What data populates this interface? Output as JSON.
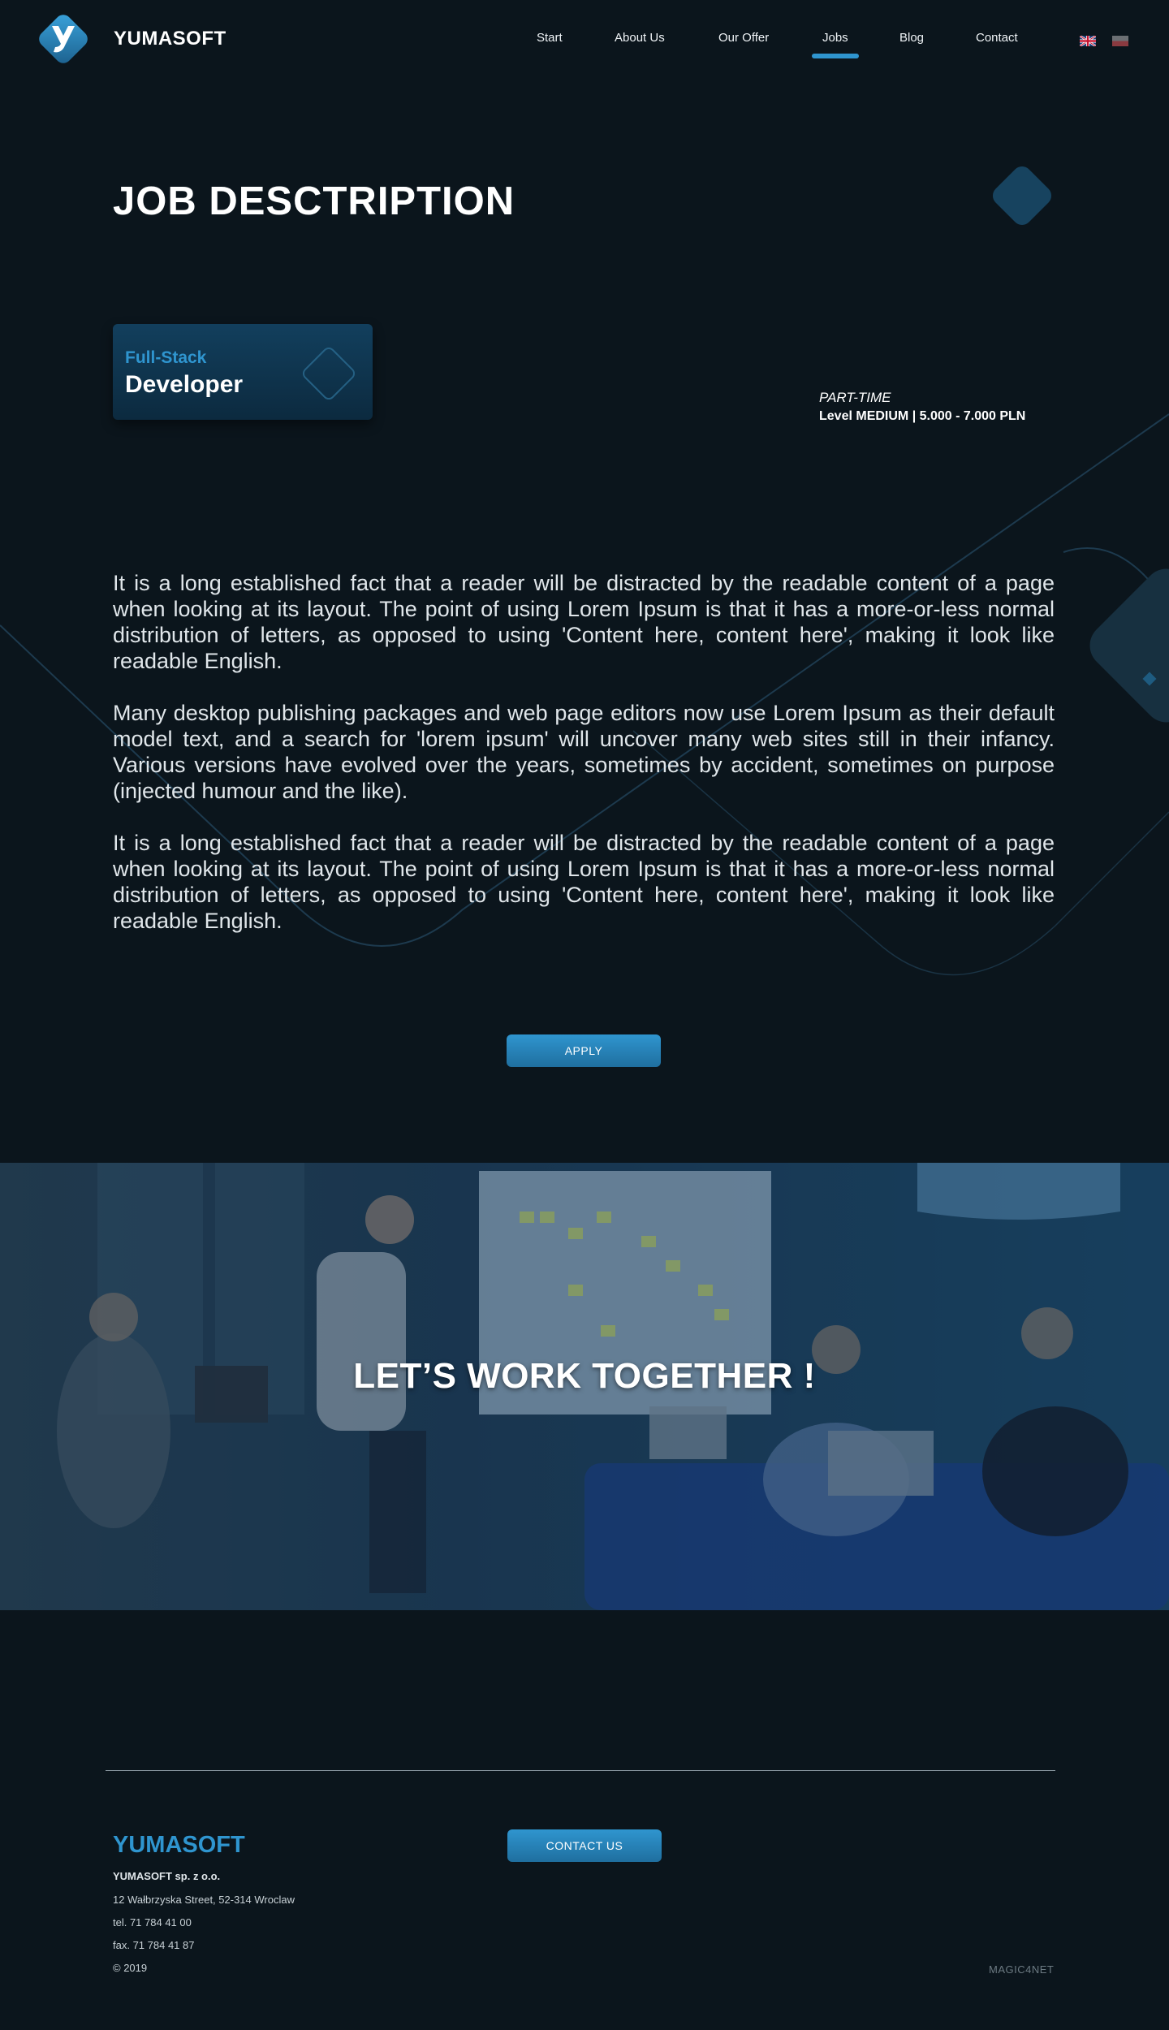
{
  "header": {
    "brand": "YUMASOFT",
    "nav": [
      {
        "label": "Start"
      },
      {
        "label": "About Us"
      },
      {
        "label": "Our Offer"
      },
      {
        "label": "Jobs",
        "active": true
      },
      {
        "label": "Blog"
      },
      {
        "label": "Contact"
      }
    ],
    "languages": [
      "en-flag-icon",
      "pl-flag-icon"
    ]
  },
  "job": {
    "page_title": "JOB DESCTRIPTION",
    "category": "Full-Stack",
    "role": "Developer",
    "type": "PART-TIME",
    "level": "Level MEDIUM | 5.000 - 7.000 PLN",
    "description": [
      "It is a long established fact that a reader will be distracted by the readable content of a page when looking at its layout. The point of using Lorem Ipsum is that it has a more-or-less normal distribution of letters, as opposed to using 'Content here, content here', making it look like readable English.",
      "Many desktop publishing packages and web page editors now use Lorem Ipsum as their default model text, and a search for 'lorem ipsum' will uncover many web sites still in their infancy. Various versions have evolved over the years, sometimes by accident, sometimes on purpose (injected humour and the like).",
      "It is a long established fact that a reader will be distracted by the readable content of a page when looking at its layout. The point of using Lorem Ipsum is that it has a more-or-less normal distribution of letters, as opposed to using 'Content here, content here', making it look like readable English."
    ],
    "apply_label": "APPLY"
  },
  "banner": {
    "title": "LET’S WORK TOGETHER !"
  },
  "footer": {
    "brand": "YUMASOFT",
    "company": "YUMASOFT sp. z o.o.",
    "address": "12 Wałbrzyska Street, 52-314 Wroclaw",
    "tel": "tel. 71 784 41 00",
    "fax": "fax. 71 784 41 87",
    "copyright": "© 2019",
    "contact_label": "CONTACT US",
    "credit": "MAGIC4NET"
  },
  "colors": {
    "background": "#0b151c",
    "accent": "#2f95cf",
    "card": "#123f5d"
  }
}
